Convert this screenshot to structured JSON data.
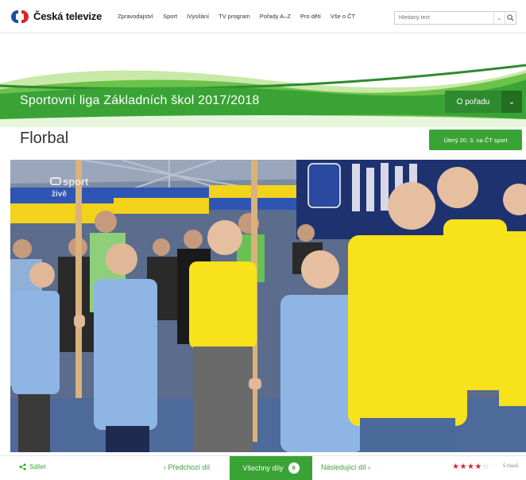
{
  "header": {
    "logo_text": "Česká televize",
    "nav": [
      "Zpravodajství",
      "Sport",
      "iVysílání",
      "TV program",
      "Pořady A–Z",
      "Pro děti",
      "Vše o ČT"
    ],
    "search_placeholder": "Hledaný text"
  },
  "banner": {
    "title": "Sportovní liga Základních škol 2017/2018",
    "button_label": "O pořadu"
  },
  "episode": {
    "title": "Florbal",
    "airdate_label": "Úterý 20. 3. na ČT sport",
    "channel_watermark": "sport",
    "live_badge": "živě"
  },
  "footer": {
    "share_label": "Sdílet",
    "prev_label": "‹ Předchozí díl",
    "all_label": "Všechny díly",
    "all_count": "9",
    "next_label": "Následující díl ›",
    "rating_value": 4,
    "rating_max": 5,
    "rating_count": "5 hlasů"
  },
  "colors": {
    "brand_green": "#3aa335",
    "dark_green": "#2e8a2e",
    "red": "#d8262c",
    "blue": "#1d4fa3"
  }
}
